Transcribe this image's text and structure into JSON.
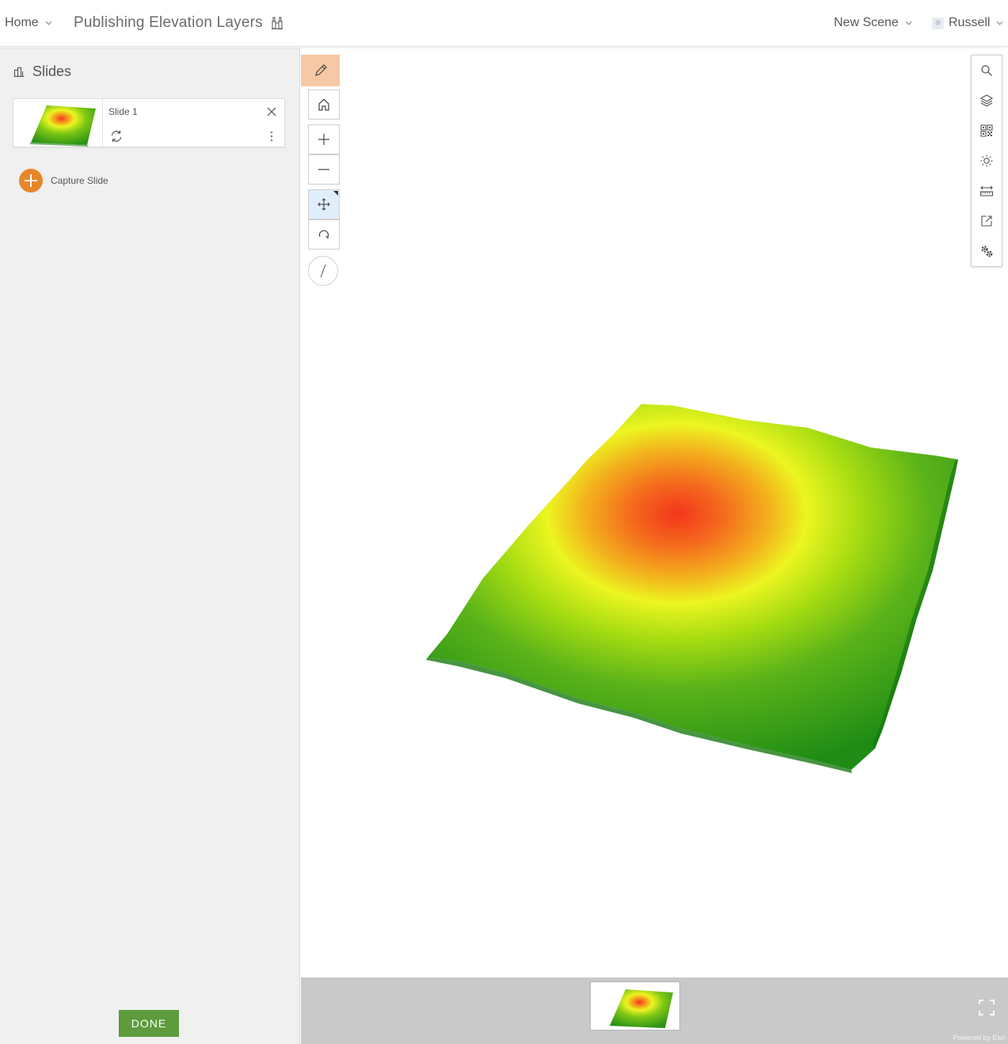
{
  "header": {
    "home_label": "Home",
    "title": "Publishing Elevation Layers",
    "new_scene_label": "New Scene",
    "user_name": "Russell"
  },
  "slides_panel": {
    "title": "Slides",
    "slides": [
      {
        "name": "Slide 1"
      }
    ],
    "capture_label": "Capture Slide",
    "done_label": "DONE"
  },
  "map": {
    "elevation_ramp": [
      "#1b8a16",
      "#4fb016",
      "#9bd80e",
      "#e6f51c",
      "#f3a21a",
      "#f2361c"
    ]
  },
  "tray": {
    "attribution": "Powered by Esri"
  },
  "colors": {
    "accent_orange": "#e8862a",
    "done_green": "#5d9b3c",
    "edit_highlight": "#f6c8a5",
    "tray_gray": "#c9c9c9"
  },
  "icons": {
    "title": "binoculars-icon",
    "slides": "slides-icon",
    "left_tools": [
      "pencil-icon",
      "home-icon",
      "plus-icon",
      "minus-icon",
      "pan-icon",
      "rotate-icon",
      "compass-icon"
    ],
    "right_tools": [
      "search-icon",
      "layers-icon",
      "qr-grid-icon",
      "sun-icon",
      "measure-icon",
      "share-icon",
      "settings-icon"
    ],
    "tray": "fullscreen-icon"
  }
}
